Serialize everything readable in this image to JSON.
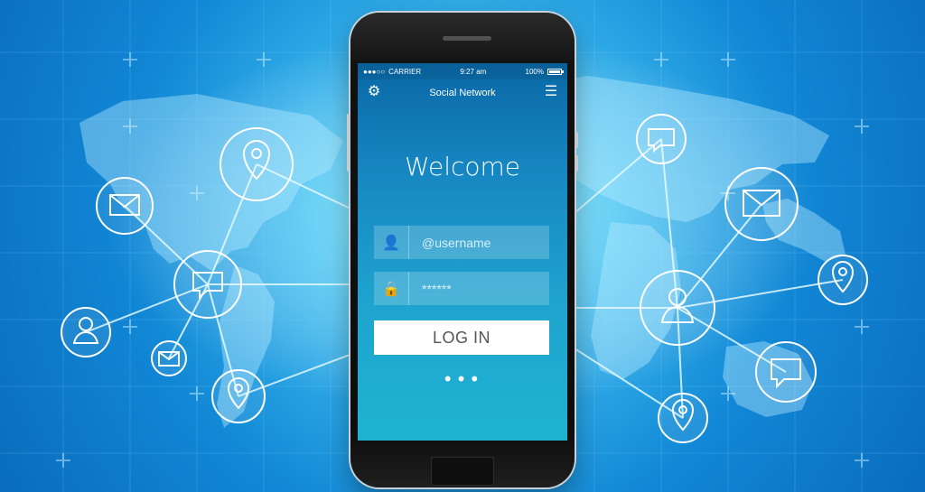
{
  "status_bar": {
    "carrier": "CARRIER",
    "time": "9:27 am",
    "battery_text": "100%",
    "battery_level": 1.0
  },
  "header": {
    "title": "Social Network",
    "settings_icon": "gear-icon",
    "menu_icon": "hamburger-icon"
  },
  "login": {
    "welcome": "Welcome",
    "username_placeholder": "@username",
    "password_placeholder": "******",
    "username_icon": "user-icon",
    "password_icon": "lock-icon",
    "button_label": "LOG IN",
    "pager": "•••"
  },
  "colors": {
    "background_primary": "#0a6cbd",
    "background_glow": "#8fe9ff",
    "screen_top": "#0a68a6",
    "screen_bottom": "#1db4d0",
    "button_bg": "#ffffff",
    "button_text": "#555555"
  },
  "network_icons": [
    "mail-icon",
    "location-pin-icon",
    "chat-icon",
    "user-icon",
    "mail-icon",
    "location-pin-icon",
    "chat-icon",
    "mail-icon",
    "location-pin-icon",
    "user-icon",
    "chat-icon",
    "location-pin-icon"
  ]
}
